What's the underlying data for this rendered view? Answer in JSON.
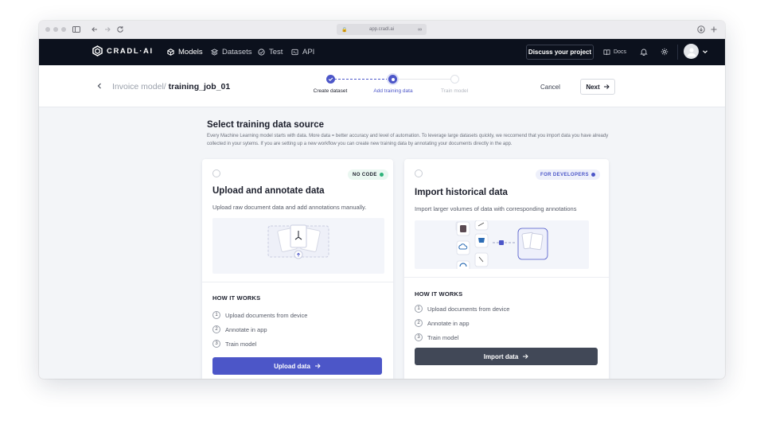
{
  "browser": {
    "url": "app.cradl.ai"
  },
  "nav": {
    "logo_text": "CRADL·AI",
    "items": [
      {
        "label": "Models",
        "icon": "models-icon",
        "active": true
      },
      {
        "label": "Datasets",
        "icon": "datasets-icon",
        "active": false
      },
      {
        "label": "Test",
        "icon": "test-icon",
        "active": false
      },
      {
        "label": "API",
        "icon": "api-icon",
        "active": false
      }
    ],
    "discuss_label": "Discuss your project",
    "docs_label": "Docs"
  },
  "header": {
    "breadcrumb_parent": "Invoice model/",
    "breadcrumb_current": "training_job_01",
    "steps": [
      {
        "label": "Create dataset",
        "state": "done"
      },
      {
        "label": "Add training data",
        "state": "current"
      },
      {
        "label": "Train model",
        "state": "todo"
      }
    ],
    "cancel_label": "Cancel",
    "next_label": "Next"
  },
  "main": {
    "title": "Select training data source",
    "description": "Every Machine Learning model starts with data. More data = better accuracy and level of automation. To leverage large datasets quickly, we reccomend that you import data you have already collected in your sytems. If you are setting up a new workflow you can create new training data by annotating your documents directly in the app.",
    "cards": [
      {
        "badge": "NO CODE",
        "badge_color": "#2fb37a",
        "title": "Upload and annotate data",
        "subtitle": "Upload raw document data and add annotations manually.",
        "how_label": "HOW IT WORKS",
        "steps": [
          "Upload documents from device",
          "Annotate in app",
          "Train model"
        ],
        "cta_label": "Upload data",
        "cta_color": "#4c56c8"
      },
      {
        "badge": "FOR DEVELOPERS",
        "badge_color": "#4c56c8",
        "title": "Import historical data",
        "subtitle": "Import larger volumes of data with corresponding annotations",
        "how_label": "HOW IT WORKS",
        "steps": [
          "Upload documents from device",
          "Annotate in app",
          "Train model"
        ],
        "cta_label": "Import data",
        "cta_color": "#414857"
      }
    ]
  }
}
